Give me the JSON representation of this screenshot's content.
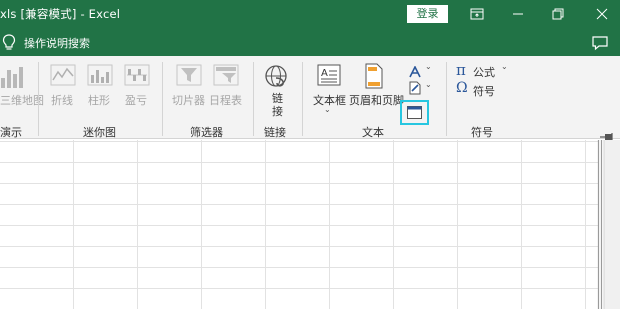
{
  "titlebar": {
    "title": "xls [兼容模式] - Excel",
    "login_label": "登录"
  },
  "tellbar": {
    "text": "操作说明搜索"
  },
  "ribbon": {
    "groups": {
      "tours": {
        "button": "三维地图",
        "label": "演示"
      },
      "sparklines": {
        "line": "折线",
        "column": "柱形",
        "winloss": "盈亏",
        "label": "迷你图"
      },
      "filters": {
        "slicer": "切片器",
        "timeline": "日程表",
        "label": "筛选器"
      },
      "links": {
        "link": "链接",
        "label": "链接"
      },
      "text": {
        "textbox": "文本框",
        "header_footer": "页眉和页脚",
        "label": "文本"
      },
      "symbols": {
        "equation": "公式",
        "symbol": "符号",
        "label": "符号"
      }
    }
  },
  "colors": {
    "excel_green": "#217346",
    "highlight": "#27c6e0"
  }
}
